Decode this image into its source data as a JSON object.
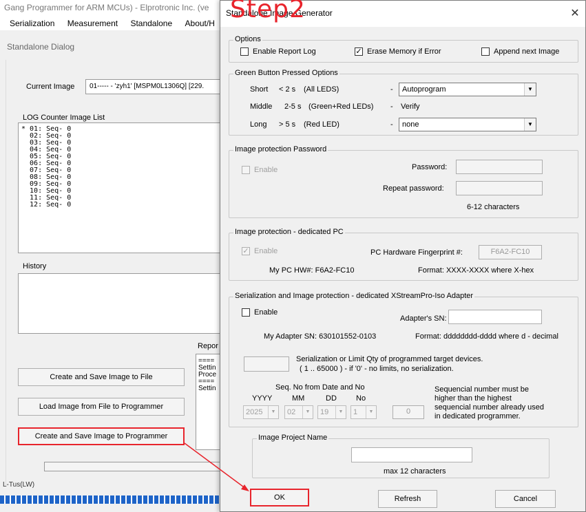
{
  "main_window": {
    "title": "Gang Programmer for ARM MCUs) - Elprotronic Inc. (ve",
    "menu": [
      "Serialization",
      "Measurement",
      "Standalone",
      "About/H"
    ],
    "dialog_title": "Standalone Dialog",
    "current_image_label": "Current Image",
    "current_image_value": "01----- - 'zyh1' [MSPM0L1306Q] [229.",
    "log_counter_label": "LOG Counter Image List",
    "log_items": [
      "* 01: Seq- 0",
      "  02: Seq- 0",
      "  03: Seq- 0",
      "  04: Seq- 0",
      "  05: Seq- 0",
      "  06: Seq- 0",
      "  07: Seq- 0",
      "  08: Seq- 0",
      "  09: Seq- 0",
      "  10: Seq- 0",
      "  11: Seq- 0",
      "  12: Seq- 0"
    ],
    "history_label": "History",
    "report_label": "Repor",
    "report_lines": [
      "====",
      "Settin",
      "Proce",
      "====",
      "Settin"
    ],
    "buttons": {
      "create_save_file": "Create and Save Image to File",
      "load_from_file": "Load Image from File to Programmer",
      "create_save_programmer": "Create and Save Image to Programmer"
    },
    "status_text": "L-Tus(LW)"
  },
  "dialog": {
    "title": "Standalone Image Generator",
    "step_label": "Step2",
    "close_glyph": "✕",
    "options": {
      "label": "Options",
      "enable_report_log": {
        "label": "Enable Report Log",
        "checked": false
      },
      "erase_memory": {
        "label": "Erase Memory if Error",
        "checked": true
      },
      "append_next": {
        "label": "Append next Image",
        "checked": false
      }
    },
    "green_button": {
      "label": "Green Button Pressed Options",
      "short": {
        "name": "Short",
        "time": "< 2 s",
        "desc": "(All LEDS)",
        "dash": "-",
        "value": "Autoprogram"
      },
      "middle": {
        "name": "Middle",
        "time": "2-5 s",
        "desc": "(Green+Red LEDs)",
        "dash": "-",
        "value": "Verify"
      },
      "long": {
        "name": "Long",
        "time": "> 5 s",
        "desc": "(Red LED)",
        "dash": "-",
        "value": "none"
      }
    },
    "password": {
      "label": "Image protection Password",
      "enable": "Enable",
      "password_label": "Password:",
      "repeat_label": "Repeat password:",
      "hint": "6-12 characters"
    },
    "dedicated_pc": {
      "label": "Image protection - dedicated PC",
      "enable": "Enable",
      "fingerprint_label": "PC Hardware Fingerprint #:",
      "fingerprint_value": "F6A2-FC10",
      "my_pc_hw": "My PC HW#:  F6A2-FC10",
      "format": "Format:  XXXX-XXXX  where X-hex"
    },
    "serialization": {
      "label": "Serialization and Image protection - dedicated XStreamPro-Iso Adapter",
      "enable": "Enable",
      "adapter_sn_label": "Adapter's SN:",
      "my_adapter_sn": "My Adapter SN:  630101552-0103",
      "format": "Format:  dddddddd-dddd  where d - decimal",
      "limit_line1": "Serialization or Limit Qty of programmed target devices.",
      "limit_line2": "( 1 .. 65000 ) - if '0' - no limits, no serialization.",
      "seq_title": "Seq. No from Date and No",
      "col_yyyy": "YYYY",
      "col_mm": "MM",
      "col_dd": "DD",
      "col_no": "No",
      "yyyy": "2025",
      "mm": "02",
      "dd": "19",
      "no": "1",
      "seq_value": "0",
      "note_line1": "Sequencial number must be",
      "note_line2": "higher than the highest",
      "note_line3": "sequencial number already used",
      "note_line4": "in dedicated programmer."
    },
    "project_name": {
      "label": "Image Project Name",
      "hint": "max 12 characters"
    },
    "buttons": {
      "ok": "OK",
      "refresh": "Refresh",
      "cancel": "Cancel"
    }
  },
  "colors": {
    "highlight": "#e8242c",
    "progress": "#1e64c8"
  }
}
